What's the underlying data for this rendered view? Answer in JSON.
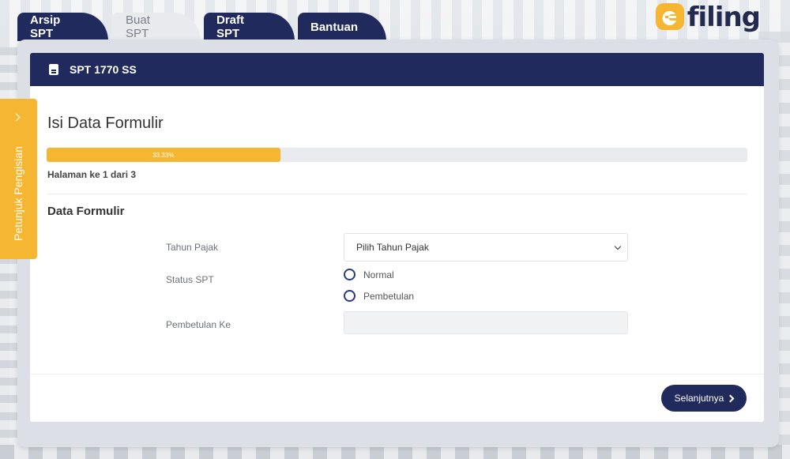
{
  "tabs": [
    {
      "label": "Arsip SPT",
      "active": true
    },
    {
      "label": "Buat SPT",
      "active": false
    },
    {
      "label": "Draft SPT",
      "active": true
    },
    {
      "label": "Bantuan",
      "active": true
    }
  ],
  "logo": {
    "prefix": "e",
    "text": "filing",
    "accent_color": "#f5b731",
    "text_color": "#222a4f"
  },
  "card": {
    "header_title": "SPT 1770 SS",
    "header_icon": "document-icon"
  },
  "form": {
    "title": "Isi Data Formulir",
    "progress_label": "33.33%",
    "progress_value": 33.33,
    "page_info": "Halaman ke 1 dari 3",
    "section_title": "Data Formulir",
    "tahun_pajak_label": "Tahun Pajak",
    "tahun_pajak_placeholder": "Pilih Tahun Pajak",
    "status_label": "Status SPT",
    "status_options": [
      "Normal",
      "Pembetulan"
    ],
    "pembetulan_label": "Pembetulan Ke",
    "pembetulan_value": ""
  },
  "next_button": "Selanjutnya",
  "side_tab": {
    "label": "Petunjuk Pengisian"
  },
  "colors": {
    "navy": "#212a5c",
    "accent": "#f5b731"
  }
}
